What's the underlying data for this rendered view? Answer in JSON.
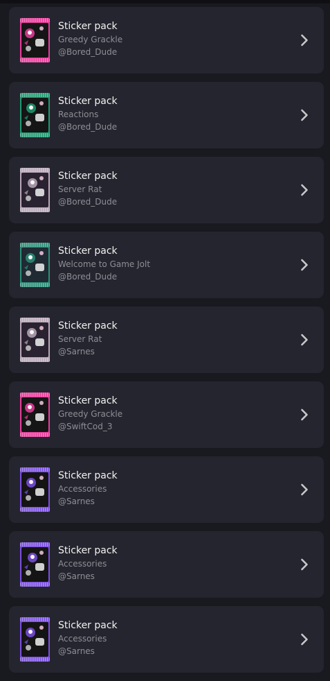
{
  "items": [
    {
      "title": "Sticker pack",
      "pack": "Greedy Grackle",
      "owner": "@Bored_Dude",
      "thumb": "greedy-grackle-pack-thumbnail",
      "accent": "#e83d9b",
      "body": "#151515"
    },
    {
      "title": "Sticker pack",
      "pack": "Reactions",
      "owner": "@Bored_Dude",
      "thumb": "reactions-pack-thumbnail",
      "accent": "#1f9a70",
      "body": "#151515"
    },
    {
      "title": "Sticker pack",
      "pack": "Server Rat",
      "owner": "@Bored_Dude",
      "thumb": "server-rat-pack-thumbnail",
      "accent": "#b9a8b8",
      "body": "#2a2230"
    },
    {
      "title": "Sticker pack",
      "pack": "Welcome to Game Jolt",
      "owner": "@Bored_Dude",
      "thumb": "welcome-pack-thumbnail",
      "accent": "#2c8f78",
      "body": "#1f2a33"
    },
    {
      "title": "Sticker pack",
      "pack": "Server Rat",
      "owner": "@Sarnes",
      "thumb": "server-rat-pack-thumbnail",
      "accent": "#b9a8b8",
      "body": "#2a2230"
    },
    {
      "title": "Sticker pack",
      "pack": "Greedy Grackle",
      "owner": "@SwiftCod_3",
      "thumb": "greedy-grackle-pack-thumbnail",
      "accent": "#e83d9b",
      "body": "#151515"
    },
    {
      "title": "Sticker pack",
      "pack": "Accessories",
      "owner": "@Sarnes",
      "thumb": "accessories-pack-thumbnail",
      "accent": "#7b4fe0",
      "body": "#141414"
    },
    {
      "title": "Sticker pack",
      "pack": "Accessories",
      "owner": "@Sarnes",
      "thumb": "accessories-pack-thumbnail",
      "accent": "#7b4fe0",
      "body": "#141414"
    },
    {
      "title": "Sticker pack",
      "pack": "Accessories",
      "owner": "@Sarnes",
      "thumb": "accessories-pack-thumbnail",
      "accent": "#7b4fe0",
      "body": "#141414"
    }
  ],
  "chevron_icon": "chevron-right-icon",
  "colors": {
    "background": "#191920",
    "card": "#25252f",
    "title": "#f2f2f2",
    "subtitle": "#8e8e96",
    "chevron": "#c8c8cc"
  }
}
